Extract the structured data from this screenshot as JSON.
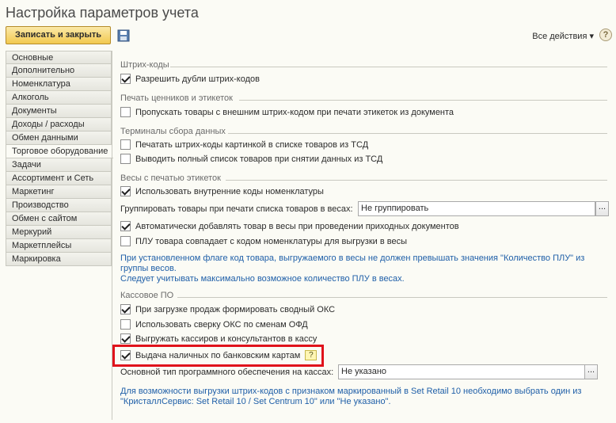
{
  "window": {
    "title": "Настройка параметров учета"
  },
  "toolbar": {
    "save_close_label": "Записать и закрыть",
    "all_actions_label": "Все действия ▾",
    "help_label": "?"
  },
  "sidebar": {
    "items": [
      {
        "label": "Основные"
      },
      {
        "label": "Дополнительно"
      },
      {
        "label": "Номенклатура"
      },
      {
        "label": "Алкоголь"
      },
      {
        "label": "Документы"
      },
      {
        "label": "Доходы / расходы"
      },
      {
        "label": "Обмен данными"
      },
      {
        "label": "Торговое оборудование",
        "active": true
      },
      {
        "label": "Задачи"
      },
      {
        "label": "Ассортимент и Сеть"
      },
      {
        "label": "Маркетинг"
      },
      {
        "label": "Производство"
      },
      {
        "label": "Обмен с сайтом"
      },
      {
        "label": "Меркурий"
      },
      {
        "label": "Маркетплейсы"
      },
      {
        "label": "Маркировка"
      }
    ]
  },
  "sections": {
    "barcodes": {
      "title": "Штрих-коды",
      "allow_duplicates": {
        "label": "Разрешить дубли штрих-кодов",
        "checked": true
      }
    },
    "labels": {
      "title": "Печать ценников и этикеток",
      "skip_external": {
        "label": "Пропускать товары с внешним штрих-кодом при печати этикеток из документа",
        "checked": false
      }
    },
    "tsd": {
      "title": "Терминалы сбора данных",
      "print_barcodes_image": {
        "label": "Печатать штрих-коды картинкой в списке товаров из ТСД",
        "checked": false
      },
      "full_list": {
        "label": "Выводить полный список товаров при снятии данных из ТСД",
        "checked": false
      }
    },
    "scales": {
      "title": "Весы с печатью этикеток",
      "internal_codes": {
        "label": "Использовать внутренние коды номенклатуры",
        "checked": true
      },
      "group_label": "Группировать товары при печати списка товаров в весах:",
      "group_value": "Не группировать",
      "auto_add": {
        "label": "Автоматически добавлять товар в весы при проведении приходных документов",
        "checked": true
      },
      "plu_match": {
        "label": "ПЛУ товара совпадает с кодом номенклатуры для выгрузки в весы",
        "checked": false
      },
      "note_line1": "При установленном флаге код товара, выгружаемого в весы не должен превышать значения \"Количество ПЛУ\" из",
      "note_line2": "группы весов.",
      "note_line3": "Следует учитывать максимально возможное количество ПЛУ в весах."
    },
    "cash": {
      "title": "Кассовое ПО",
      "summary_oks": {
        "label": "При загрузке продаж формировать сводный ОКС",
        "checked": true
      },
      "reconcile_ofd": {
        "label": "Использовать сверку ОКС по сменам ОФД",
        "checked": false
      },
      "export_cashiers": {
        "label": "Выгружать кассиров и консультантов в кассу",
        "checked": true
      },
      "cash_withdrawal": {
        "label": "Выдача наличных по банковским картам",
        "checked": true
      },
      "software_label": "Основной тип программного обеспечения на кассах:",
      "software_value": "Не указано",
      "note_line1": "Для возможности выгрузки штрих-кодов с признаком маркированный в Set Retail 10 необходимо выбрать один из",
      "note_line2": "\"КристаллСервис: Set Retail 10 / Set Centrum 10\" или \"Не указано\"."
    }
  },
  "colors": {
    "accent_button": "#f2c94f",
    "note_text": "#1f5fa8",
    "highlight_box": "#e0121b"
  }
}
